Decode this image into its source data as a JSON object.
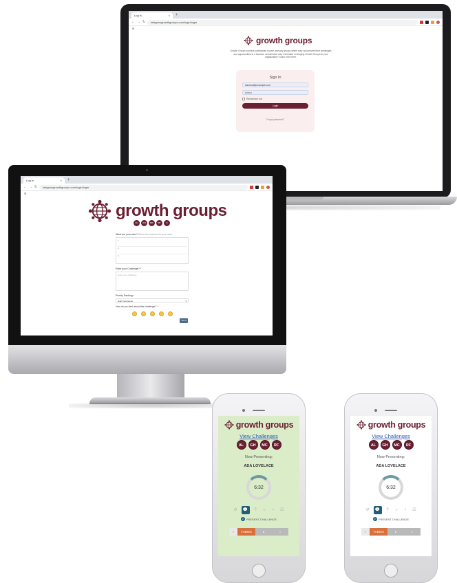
{
  "laptop": {
    "tab_title": "Log in",
    "tab_close": "×",
    "new_tab": "+",
    "url": "letsgrowgrowthgroups.com/login/login",
    "bookmark": "⊞",
    "app_title": "growth groups",
    "description": "Growth Groups connect participants in peer advisory groups where they can present their challenges and opportunities in a focused, self-directed way. Interested in bringing Growth Groups to your organization? Learn more here.",
    "signin": {
      "title": "Sign In",
      "email_value": "ssicloud@example.com",
      "password_value": "••••••••",
      "remember_label": "Remember me",
      "login_label": "Login",
      "forgot_label": "Forgot password?"
    }
  },
  "monitor": {
    "tab_title": "Log in",
    "tab_close": "×",
    "new_tab": "+",
    "url": "letsgrowgrowthgroups.com/login/login",
    "bookmark": "⊞",
    "app_title": "growth groups",
    "avatars": [
      "AL",
      "GH",
      "MC",
      "RF",
      "S"
    ],
    "form": {
      "q1_label": "What are your wins?",
      "q1_hint": "Share the reasons for your wins.",
      "q1_lines": [
        "1.",
        "2.",
        "3."
      ],
      "q2_label": "Enter your Challenge? *",
      "q2_placeholder": "Enter your challenge",
      "q3_label": "Priority Ranking *",
      "q3_value": "High Importance",
      "q4_label": "How do you feel about this challenge? *",
      "send_label": "Send"
    }
  },
  "phone_left": {
    "app_title": "growth groups",
    "link": "View Challenges",
    "avatars": [
      "AL",
      "GH",
      "MC",
      "RF"
    ],
    "now_presenting": "Now Presenting:",
    "presenter": "ADA LOVELACE",
    "timer": "6:32",
    "present_label": "PRESENT CHALLENGE",
    "badge": "2",
    "controls": [
      "«",
      "TABOO",
      "II",
      "»"
    ],
    "bg": "#dbecc9"
  },
  "phone_right": {
    "app_title": "growth groups",
    "link": "View Challenges",
    "avatars": [
      "AL",
      "GH",
      "MC",
      "RF"
    ],
    "now_presenting": "Now Presenting:",
    "presenter": "ADA LOVELACE",
    "timer": "6:32",
    "present_label": "PRESENT CHALLENGE",
    "badge": "2",
    "controls": [
      "«",
      "TABOO",
      "II",
      "»"
    ],
    "bg": "#ffffff"
  },
  "colors": {
    "brand": "#6b2032",
    "accent": "#1f5f7a",
    "taboo": "#d9703a",
    "link": "#2a5bb3"
  },
  "icons": [
    "globe-logo-icon",
    "back-icon",
    "forward-icon",
    "reload-icon",
    "lock-icon",
    "emoji-icon",
    "chat-icon",
    "gear-icon",
    "bulb-icon"
  ]
}
